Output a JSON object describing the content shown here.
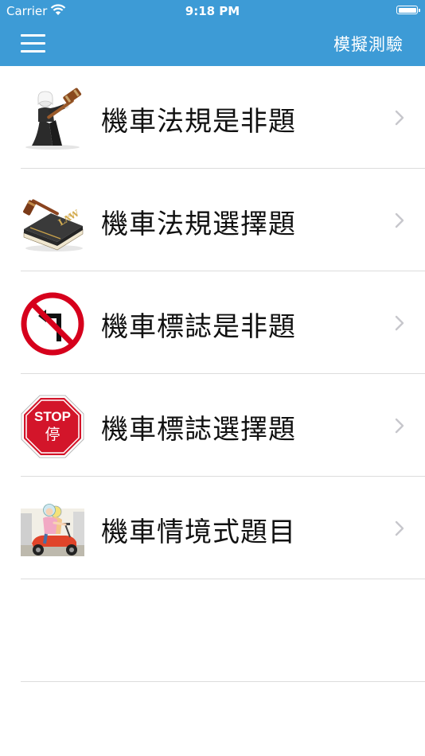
{
  "status_bar": {
    "carrier": "Carrier",
    "time": "9:18 PM"
  },
  "nav": {
    "right_button": "模擬測驗"
  },
  "colors": {
    "header": "#3d9bd6",
    "separator": "#dcdcdc",
    "chevron": "#c7c7cc"
  },
  "items": [
    {
      "label": "機車法規是非題",
      "icon": "judge-gavel-icon"
    },
    {
      "label": "機車法規選擇題",
      "icon": "law-book-gavel-icon"
    },
    {
      "label": "機車標誌是非題",
      "icon": "no-left-turn-sign-icon"
    },
    {
      "label": "機車標誌選擇題",
      "icon": "stop-sign-icon"
    },
    {
      "label": "機車情境式題目",
      "icon": "scooter-riders-icon"
    }
  ],
  "stop_sign": {
    "text": "STOP",
    "subtext": "停"
  },
  "law_book": {
    "text": "LAW",
    "small": "THE"
  }
}
